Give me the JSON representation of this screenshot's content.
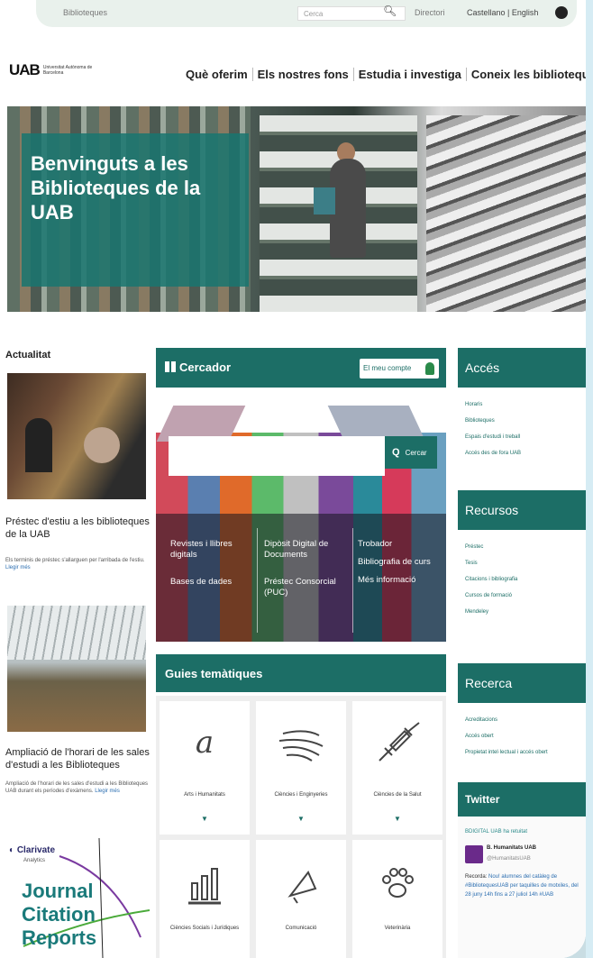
{
  "topbar": {
    "crumb": "Biblioteques",
    "search_placeholder": "Cerca",
    "directory": "Directori",
    "languages": "Castellano | English"
  },
  "logo": {
    "mark": "UAB",
    "subtitle": "Universitat Autònoma de Barcelona"
  },
  "nav": [
    "Què oferim",
    "Els nostres fons",
    "Estudia i investiga",
    "Coneix les biblioteques"
  ],
  "hero": {
    "title": "Benvinguts a les Biblioteques de la UAB"
  },
  "news": {
    "heading": "Actualitat",
    "items": [
      {
        "title": "Préstec d'estiu a les biblioteques de la UAB",
        "text": "Els terminis de préstec s'allarguen per l'arribada de l'estiu.",
        "more": "Llegir més"
      },
      {
        "title": "Ampliació de l'horari de les sales d'estudi a les Biblioteques",
        "text": "Ampliació de l'horari de les sales d'estudi a les Biblioteques UAB durant els períodes d'exàmens.",
        "more": "Llegir més"
      }
    ],
    "clarivate": {
      "brand": "Clarivate",
      "brand_sub": "Analytics",
      "jcr_line1": "Journal",
      "jcr_line2": "Citation",
      "jcr_line3": "Reports"
    }
  },
  "cercador": {
    "title": "Cercador",
    "account": "El meu compte",
    "search_button": "Cercar",
    "links_col1": [
      "Revistes i llibres digitals",
      "Bases de dades"
    ],
    "links_col2": [
      "Dipòsit Digital de Documents",
      "Préstec Consorcial (PUC)"
    ],
    "links_col3": [
      "Trobador",
      "Bibliografia de curs",
      "Més informació"
    ]
  },
  "guies": {
    "title": "Guies temàtiques",
    "cells": [
      {
        "label": "Arts i Humanitats",
        "icon": "letter-a-icon"
      },
      {
        "label": "Ciències i Enginyeries",
        "icon": "wind-icon"
      },
      {
        "label": "Ciències de la Salut",
        "icon": "syringe-icon"
      },
      {
        "label": "Ciències Socials i Jurídiques",
        "icon": "bar-chart-icon"
      },
      {
        "label": "Comunicació",
        "icon": "megaphone-icon"
      },
      {
        "label": "Veterinària",
        "icon": "paw-icon"
      }
    ]
  },
  "sidebar": {
    "acces": {
      "title": "Accés",
      "links": [
        "Horaris",
        "Biblioteques",
        "Espais d'estudi i treball",
        "Accés des de fora UAB"
      ]
    },
    "recursos": {
      "title": "Recursos",
      "links": [
        "Préstec",
        "Tesis",
        "Citacions i bibliografia",
        "Cursos de formació",
        "Mendeley"
      ]
    },
    "recerca": {
      "title": "Recerca",
      "links": [
        "Acreditacions",
        "Accés obert",
        "Propietat intel·lectual i accés obert"
      ]
    },
    "twitter": {
      "title": "Twitter",
      "retweet": "BDIGITAL UAB ha retuitat",
      "name": "B. Humanitats UAB",
      "handle": "@HumanitatsUAB",
      "body_a": "Recorda: ",
      "body_b": "Nou! alumnes del catàleg de #BibliotequesUAB per taquilles de motxiles, del 28 juny 14h fins a 27 juliol 14h #UAB"
    }
  },
  "colors": {
    "accent": "#1c6e66",
    "link": "#2a6db0"
  }
}
